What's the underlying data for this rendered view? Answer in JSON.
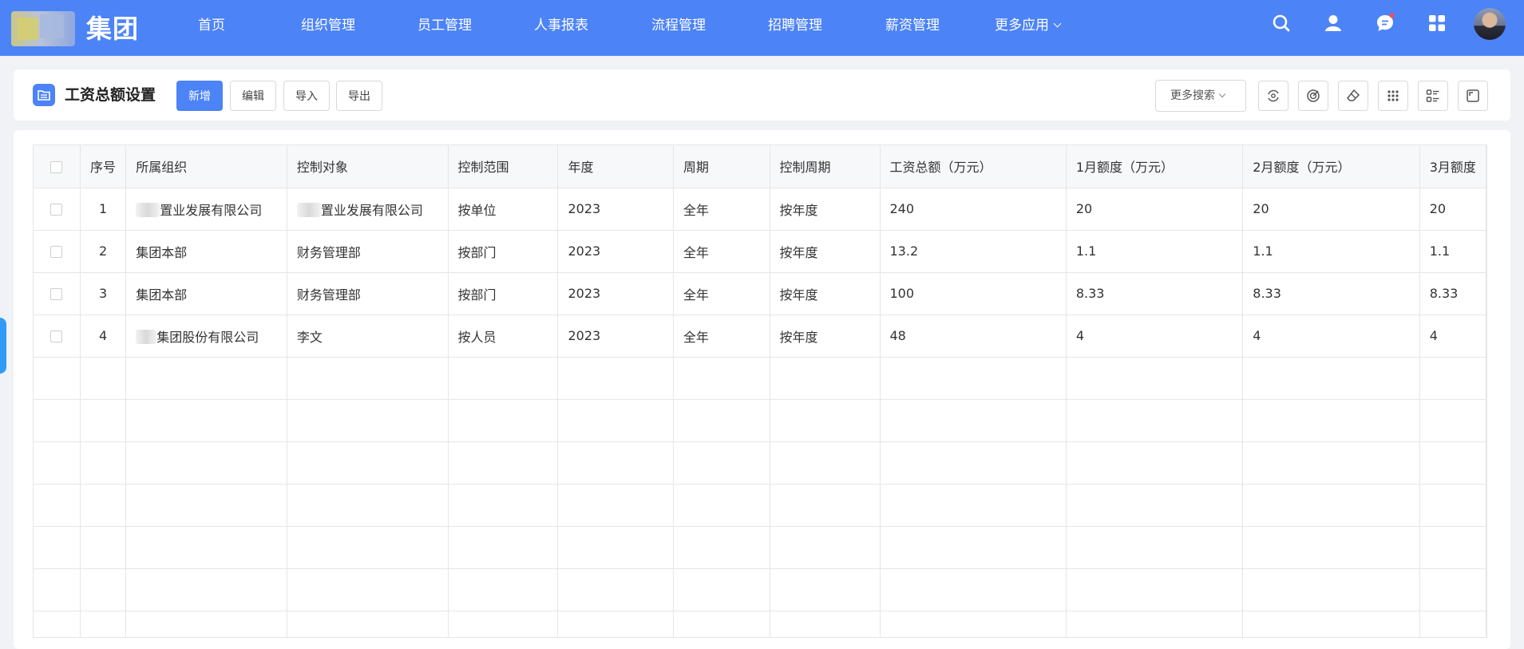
{
  "brand": {
    "logo_text": "集团"
  },
  "nav": {
    "items": [
      {
        "label": "首页"
      },
      {
        "label": "组织管理"
      },
      {
        "label": "员工管理"
      },
      {
        "label": "人事报表"
      },
      {
        "label": "流程管理"
      },
      {
        "label": "招聘管理"
      },
      {
        "label": "薪资管理"
      },
      {
        "label": "更多应用"
      }
    ]
  },
  "toolbar": {
    "title": "工资总额设置",
    "buttons": {
      "add": "新增",
      "edit": "编辑",
      "import": "导入",
      "export": "导出"
    },
    "more_search": "更多搜索"
  },
  "table": {
    "headers": {
      "index": "序号",
      "org": "所属组织",
      "target": "控制对象",
      "scope": "控制范围",
      "year": "年度",
      "period": "周期",
      "ctrl_period": "控制周期",
      "total": "工资总额（万元）",
      "m1": "1月额度（万元）",
      "m2": "2月额度（万元）",
      "m3": "3月额度"
    },
    "rows": [
      {
        "index": "1",
        "org": "置业发展有限公司",
        "target": "置业发展有限公司",
        "scope": "按单位",
        "year": "2023",
        "period": "全年",
        "ctrl_period": "按年度",
        "total": "240",
        "m1": "20",
        "m2": "20",
        "m3": "20"
      },
      {
        "index": "2",
        "org": "集团本部",
        "target": "财务管理部",
        "scope": "按部门",
        "year": "2023",
        "period": "全年",
        "ctrl_period": "按年度",
        "total": "13.2",
        "m1": "1.1",
        "m2": "1.1",
        "m3": "1.1"
      },
      {
        "index": "3",
        "org": "集团本部",
        "target": "财务管理部",
        "scope": "按部门",
        "year": "2023",
        "period": "全年",
        "ctrl_period": "按年度",
        "total": "100",
        "m1": "8.33",
        "m2": "8.33",
        "m3": "8.33"
      },
      {
        "index": "4",
        "org": "集团股份有限公司",
        "target": "李文",
        "scope": "按人员",
        "year": "2023",
        "period": "全年",
        "ctrl_period": "按年度",
        "total": "48",
        "m1": "4",
        "m2": "4",
        "m3": "4"
      }
    ]
  },
  "colors": {
    "primary": "#4c83f7",
    "side_tab": "#2f9bf7"
  }
}
